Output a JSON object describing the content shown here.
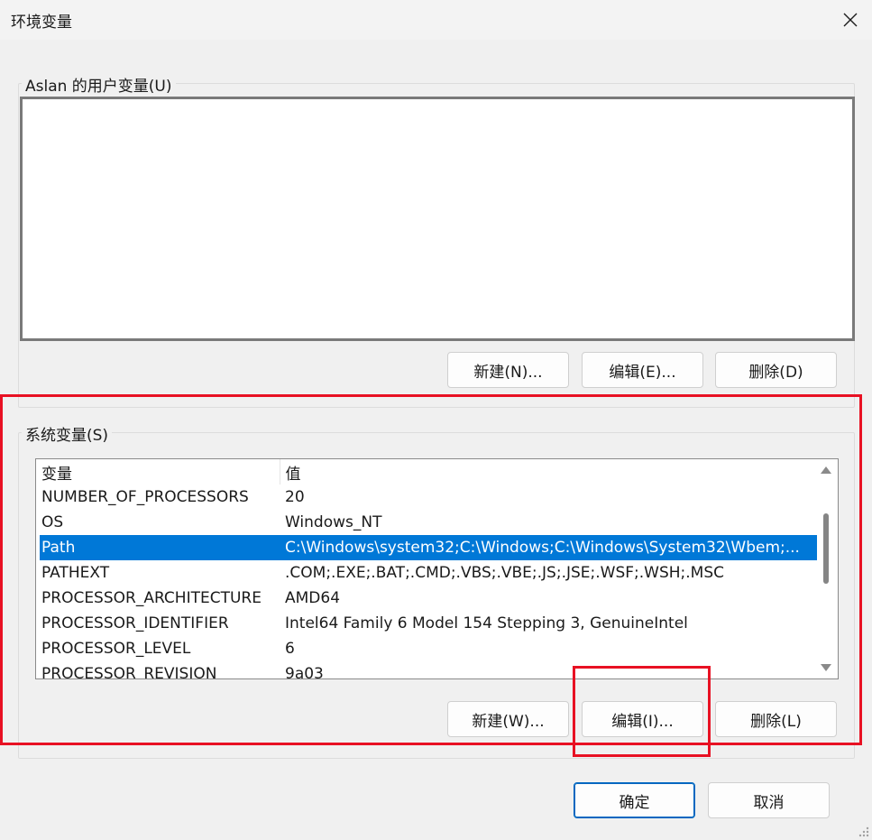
{
  "window": {
    "title": "环境变量"
  },
  "user_vars": {
    "label": "Aslan 的用户变量(U)",
    "new_label": "新建(N)...",
    "edit_label": "编辑(E)...",
    "delete_label": "删除(D)"
  },
  "system_vars": {
    "label": "系统变量(S)",
    "col_var": "变量",
    "col_value": "值",
    "rows": [
      {
        "name": "NUMBER_OF_PROCESSORS",
        "value": "20"
      },
      {
        "name": "OS",
        "value": "Windows_NT"
      },
      {
        "name": "Path",
        "value": "C:\\Windows\\system32;C:\\Windows;C:\\Windows\\System32\\Wbem;..."
      },
      {
        "name": "PATHEXT",
        "value": ".COM;.EXE;.BAT;.CMD;.VBS;.VBE;.JS;.JSE;.WSF;.WSH;.MSC"
      },
      {
        "name": "PROCESSOR_ARCHITECTURE",
        "value": "AMD64"
      },
      {
        "name": "PROCESSOR_IDENTIFIER",
        "value": "Intel64 Family 6 Model 154 Stepping 3, GenuineIntel"
      },
      {
        "name": "PROCESSOR_LEVEL",
        "value": "6"
      },
      {
        "name": "PROCESSOR_REVISION",
        "value": "9a03"
      }
    ],
    "selected_row": "Path",
    "new_label": "新建(W)...",
    "edit_label": "编辑(I)...",
    "delete_label": "删除(L)"
  },
  "footer": {
    "ok_label": "确定",
    "cancel_label": "取消"
  },
  "colors": {
    "selection": "#0078d7",
    "highlight": "#e81123",
    "primary_border": "#0067c0"
  }
}
